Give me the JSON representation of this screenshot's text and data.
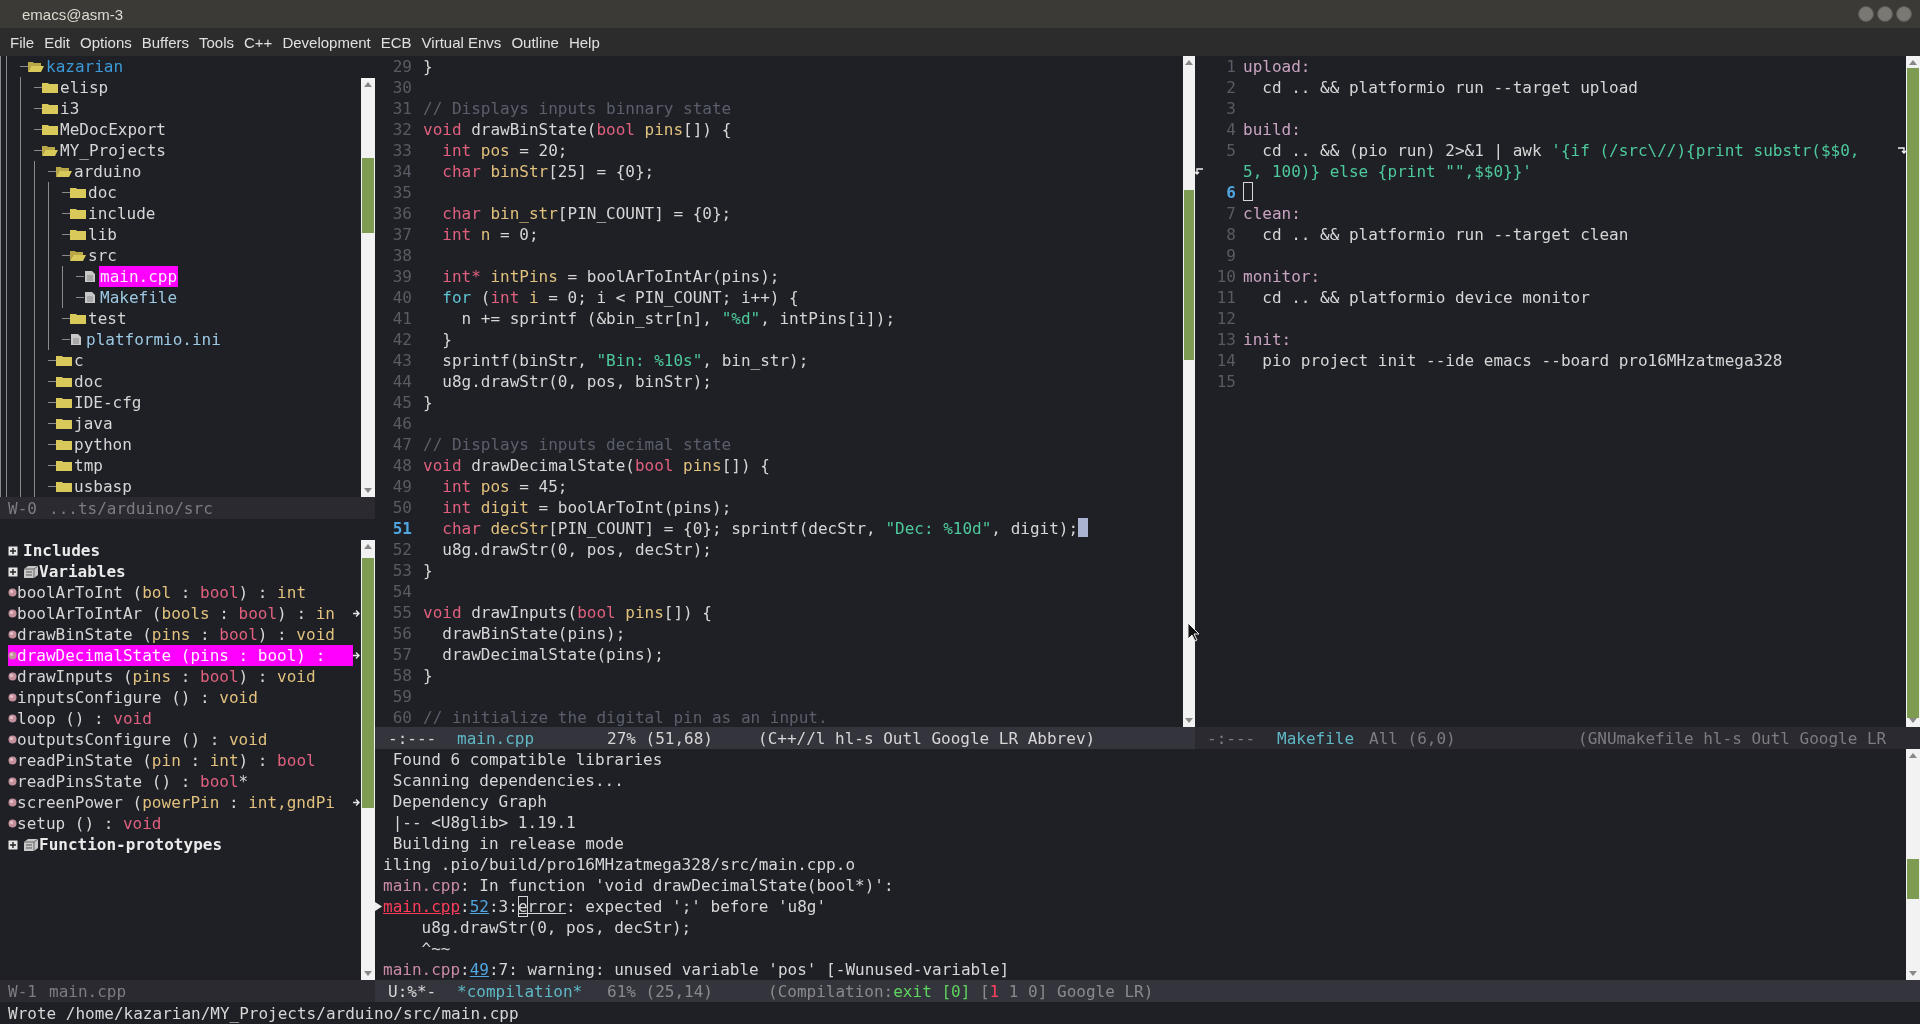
{
  "window": {
    "title": "emacs@asm-3"
  },
  "menu": [
    "File",
    "Edit",
    "Options",
    "Buffers",
    "Tools",
    "C++",
    "Development",
    "ECB",
    "Virtual Envs",
    "Outline",
    "Help"
  ],
  "directory_tree": {
    "items": [
      {
        "name": "kazarian",
        "kind": "folder",
        "expanded": true,
        "selected": false,
        "children": [
          {
            "name": "elisp",
            "kind": "folder",
            "expanded": false,
            "selected": false
          },
          {
            "name": "i3",
            "kind": "folder",
            "expanded": false,
            "selected": false
          },
          {
            "name": "MeDocExport",
            "kind": "folder",
            "expanded": false,
            "selected": false
          },
          {
            "name": "MY_Projects",
            "kind": "folder",
            "expanded": true,
            "selected": false,
            "children": [
              {
                "name": "arduino",
                "kind": "folder",
                "expanded": true,
                "selected": false,
                "children": [
                  {
                    "name": "doc",
                    "kind": "folder",
                    "expanded": false,
                    "selected": false
                  },
                  {
                    "name": "include",
                    "kind": "folder",
                    "expanded": false,
                    "selected": false
                  },
                  {
                    "name": "lib",
                    "kind": "folder",
                    "expanded": false,
                    "selected": false
                  },
                  {
                    "name": "src",
                    "kind": "folder",
                    "expanded": true,
                    "selected": false,
                    "children": [
                      {
                        "name": "main.cpp",
                        "kind": "file",
                        "selected": true
                      },
                      {
                        "name": "Makefile",
                        "kind": "file",
                        "selected": false
                      }
                    ]
                  },
                  {
                    "name": "test",
                    "kind": "folder",
                    "expanded": false,
                    "selected": false
                  },
                  {
                    "name": "platformio.ini",
                    "kind": "file",
                    "selected": false
                  }
                ]
              },
              {
                "name": "c",
                "kind": "folder",
                "expanded": false,
                "selected": false
              },
              {
                "name": "doc",
                "kind": "folder",
                "expanded": false,
                "selected": false
              },
              {
                "name": "IDE-cfg",
                "kind": "folder",
                "expanded": false,
                "selected": false
              },
              {
                "name": "java",
                "kind": "folder",
                "expanded": false,
                "selected": false
              },
              {
                "name": "python",
                "kind": "folder",
                "expanded": false,
                "selected": false
              },
              {
                "name": "tmp",
                "kind": "folder",
                "expanded": false,
                "selected": false
              },
              {
                "name": "usbasp",
                "kind": "folder",
                "expanded": false,
                "selected": false
              }
            ]
          }
        ]
      }
    ],
    "mode_line": {
      "active": false,
      "segments": [
        {
          "kind": "dim",
          "text": "W-0"
        },
        {
          "kind": "dim",
          "text": "...ts/arduino/src"
        }
      ]
    }
  },
  "methods": {
    "items": [
      {
        "kind": "group",
        "label": "Includes",
        "icon": false
      },
      {
        "kind": "group",
        "label": "Variables",
        "icon": true
      },
      {
        "kind": "method",
        "selected": false,
        "truncated": false,
        "tokens": [
          {
            "kind": "txt",
            "text": "boolArToInt ("
          },
          {
            "kind": "var",
            "text": "bol"
          },
          {
            "kind": "txt",
            "text": " : "
          },
          {
            "kind": "kw",
            "text": "bool"
          },
          {
            "kind": "txt",
            "text": ") : "
          },
          {
            "kind": "var",
            "text": "int"
          }
        ]
      },
      {
        "kind": "method",
        "selected": false,
        "truncated": true,
        "tokens": [
          {
            "kind": "txt",
            "text": "boolArToIntAr ("
          },
          {
            "kind": "var",
            "text": "bools"
          },
          {
            "kind": "txt",
            "text": " : "
          },
          {
            "kind": "kw",
            "text": "bool"
          },
          {
            "kind": "txt",
            "text": ") : "
          },
          {
            "kind": "var",
            "text": "in"
          }
        ]
      },
      {
        "kind": "method",
        "selected": false,
        "truncated": false,
        "tokens": [
          {
            "kind": "txt",
            "text": "drawBinState ("
          },
          {
            "kind": "var",
            "text": "pins"
          },
          {
            "kind": "txt",
            "text": " : "
          },
          {
            "kind": "kw",
            "text": "bool"
          },
          {
            "kind": "txt",
            "text": ") : "
          },
          {
            "kind": "var",
            "text": "void"
          }
        ]
      },
      {
        "kind": "method",
        "selected": true,
        "truncated": true,
        "tokens": [
          {
            "kind": "txt",
            "text": "drawDecimalState ("
          },
          {
            "kind": "var",
            "text": "pins"
          },
          {
            "kind": "txt",
            "text": " : "
          },
          {
            "kind": "kw",
            "text": "bool"
          },
          {
            "kind": "txt",
            "text": ") :"
          }
        ]
      },
      {
        "kind": "method",
        "selected": false,
        "truncated": false,
        "tokens": [
          {
            "kind": "txt",
            "text": "drawInputs ("
          },
          {
            "kind": "var",
            "text": "pins"
          },
          {
            "kind": "txt",
            "text": " : "
          },
          {
            "kind": "kw",
            "text": "bool"
          },
          {
            "kind": "txt",
            "text": ") : "
          },
          {
            "kind": "var",
            "text": "void"
          }
        ]
      },
      {
        "kind": "method",
        "selected": false,
        "truncated": false,
        "tokens": [
          {
            "kind": "txt",
            "text": "inputsConfigure () : "
          },
          {
            "kind": "var",
            "text": "void"
          }
        ]
      },
      {
        "kind": "method",
        "selected": false,
        "truncated": false,
        "tokens": [
          {
            "kind": "txt",
            "text": "loop () : "
          },
          {
            "kind": "kw",
            "text": "void"
          }
        ]
      },
      {
        "kind": "method",
        "selected": false,
        "truncated": false,
        "tokens": [
          {
            "kind": "txt",
            "text": "outputsConfigure () : "
          },
          {
            "kind": "var",
            "text": "void"
          }
        ]
      },
      {
        "kind": "method",
        "selected": false,
        "truncated": false,
        "tokens": [
          {
            "kind": "txt",
            "text": "readPinState ("
          },
          {
            "kind": "var",
            "text": "pin"
          },
          {
            "kind": "txt",
            "text": " : "
          },
          {
            "kind": "var",
            "text": "int"
          },
          {
            "kind": "txt",
            "text": ") : "
          },
          {
            "kind": "kw",
            "text": "bool"
          }
        ]
      },
      {
        "kind": "method",
        "selected": false,
        "truncated": false,
        "tokens": [
          {
            "kind": "txt",
            "text": "readPinsState () : "
          },
          {
            "kind": "kw",
            "text": "bool"
          },
          {
            "kind": "txt",
            "text": "*"
          }
        ]
      },
      {
        "kind": "method",
        "selected": false,
        "truncated": true,
        "tokens": [
          {
            "kind": "txt",
            "text": "screenPower ("
          },
          {
            "kind": "var",
            "text": "powerPin"
          },
          {
            "kind": "txt",
            "text": " : "
          },
          {
            "kind": "var",
            "text": "int,gndPi"
          }
        ]
      },
      {
        "kind": "method",
        "selected": false,
        "truncated": false,
        "tokens": [
          {
            "kind": "txt",
            "text": "setup () : "
          },
          {
            "kind": "kw",
            "text": "void"
          }
        ]
      },
      {
        "kind": "group",
        "label": "Function-prototypes",
        "icon": true
      }
    ],
    "mode_line": {
      "active": false,
      "segments": [
        {
          "kind": "dim",
          "text": "W-1"
        },
        {
          "kind": "dim",
          "text": "main.cpp"
        }
      ]
    }
  },
  "code_editor": {
    "lines": [
      {
        "number": "29",
        "current": false,
        "tokens": [
          {
            "kind": "txt",
            "text": "}"
          }
        ]
      },
      {
        "number": "30",
        "current": false
      },
      {
        "number": "31",
        "current": false,
        "tokens": [
          {
            "kind": "cmt",
            "text": "// Displays inputs binnary state"
          }
        ]
      },
      {
        "number": "32",
        "current": false,
        "tokens": [
          {
            "kind": "kw",
            "text": "void"
          },
          {
            "kind": "txt",
            "text": " drawBinState("
          },
          {
            "kind": "kw",
            "text": "bool"
          },
          {
            "kind": "var",
            "text": " pins"
          },
          {
            "kind": "txt",
            "text": "[]) {"
          }
        ]
      },
      {
        "number": "33",
        "current": false,
        "tokens": [
          {
            "kind": "kw",
            "text": "  int"
          },
          {
            "kind": "var",
            "text": " pos"
          },
          {
            "kind": "txt",
            "text": " = 20;"
          }
        ]
      },
      {
        "number": "34",
        "current": false,
        "tokens": [
          {
            "kind": "kw",
            "text": "  char"
          },
          {
            "kind": "var",
            "text": " binStr"
          },
          {
            "kind": "txt",
            "text": "[25] = {0};"
          }
        ]
      },
      {
        "number": "35",
        "current": false
      },
      {
        "number": "36",
        "current": false,
        "tokens": [
          {
            "kind": "kw",
            "text": "  char"
          },
          {
            "kind": "var",
            "text": " bin_str"
          },
          {
            "kind": "txt",
            "text": "[PIN_COUNT] = {0};"
          }
        ]
      },
      {
        "number": "37",
        "current": false,
        "tokens": [
          {
            "kind": "kw",
            "text": "  int"
          },
          {
            "kind": "var",
            "text": " n"
          },
          {
            "kind": "txt",
            "text": " = 0;"
          }
        ]
      },
      {
        "number": "38",
        "current": false
      },
      {
        "number": "39",
        "current": false,
        "tokens": [
          {
            "kind": "kw",
            "text": "  int*"
          },
          {
            "kind": "var",
            "text": " intPins"
          },
          {
            "kind": "txt",
            "text": " = boolArToIntAr(pins);"
          }
        ]
      },
      {
        "number": "40",
        "current": false,
        "tokens": [
          {
            "kind": "ctl",
            "text": "  for"
          },
          {
            "kind": "txt",
            "text": " ("
          },
          {
            "kind": "kw",
            "text": "int"
          },
          {
            "kind": "var",
            "text": " i"
          },
          {
            "kind": "txt",
            "text": " = 0; i < PIN_COUNT; i++) {"
          }
        ]
      },
      {
        "number": "41",
        "current": false,
        "tokens": [
          {
            "kind": "txt",
            "text": "    n += sprintf (&bin_str[n], "
          },
          {
            "kind": "str",
            "text": "\"%d\""
          },
          {
            "kind": "txt",
            "text": ", intPins[i]);"
          }
        ]
      },
      {
        "number": "42",
        "current": false,
        "tokens": [
          {
            "kind": "txt",
            "text": "  }"
          }
        ]
      },
      {
        "number": "43",
        "current": false,
        "tokens": [
          {
            "kind": "txt",
            "text": "  sprintf(binStr, "
          },
          {
            "kind": "str",
            "text": "\"Bin: %10s\""
          },
          {
            "kind": "txt",
            "text": ", bin_str);"
          }
        ]
      },
      {
        "number": "44",
        "current": false,
        "tokens": [
          {
            "kind": "txt",
            "text": "  u8g.drawStr(0, pos, binStr);"
          }
        ]
      },
      {
        "number": "45",
        "current": false,
        "tokens": [
          {
            "kind": "txt",
            "text": "}"
          }
        ]
      },
      {
        "number": "46",
        "current": false
      },
      {
        "number": "47",
        "current": false,
        "tokens": [
          {
            "kind": "cmt",
            "text": "// Displays inputs decimal state"
          }
        ]
      },
      {
        "number": "48",
        "current": false,
        "tokens": [
          {
            "kind": "kw",
            "text": "void"
          },
          {
            "kind": "txt",
            "text": " drawDecimalState("
          },
          {
            "kind": "kw",
            "text": "bool"
          },
          {
            "kind": "var",
            "text": " pins"
          },
          {
            "kind": "txt",
            "text": "[]) {"
          }
        ]
      },
      {
        "number": "49",
        "current": false,
        "tokens": [
          {
            "kind": "kw",
            "text": "  int"
          },
          {
            "kind": "var",
            "text": " pos"
          },
          {
            "kind": "txt",
            "text": " = 45;"
          }
        ]
      },
      {
        "number": "50",
        "current": false,
        "tokens": [
          {
            "kind": "kw",
            "text": "  int"
          },
          {
            "kind": "var",
            "text": " digit"
          },
          {
            "kind": "txt",
            "text": " = boolArToInt(pins);"
          }
        ]
      },
      {
        "number": "51",
        "current": true,
        "tokens": [
          {
            "kind": "kw",
            "text": "  char"
          },
          {
            "kind": "var",
            "text": " decStr"
          },
          {
            "kind": "txt",
            "text": "[PIN_COUNT] = {0}; sprintf(decStr, "
          },
          {
            "kind": "str",
            "text": "\"Dec: %10d\""
          },
          {
            "kind": "txt",
            "text": ", digit);"
          }
        ]
      },
      {
        "number": "52",
        "current": false,
        "tokens": [
          {
            "kind": "txt",
            "text": "  u8g.drawStr(0, pos, decStr);"
          }
        ]
      },
      {
        "number": "53",
        "current": false,
        "tokens": [
          {
            "kind": "txt",
            "text": "}"
          }
        ]
      },
      {
        "number": "54",
        "current": false
      },
      {
        "number": "55",
        "current": false,
        "tokens": [
          {
            "kind": "kw",
            "text": "void"
          },
          {
            "kind": "txt",
            "text": " drawInputs("
          },
          {
            "kind": "kw",
            "text": "bool"
          },
          {
            "kind": "var",
            "text": " pins"
          },
          {
            "kind": "txt",
            "text": "[]) {"
          }
        ]
      },
      {
        "number": "56",
        "current": false,
        "tokens": [
          {
            "kind": "txt",
            "text": "  drawBinState(pins);"
          }
        ]
      },
      {
        "number": "57",
        "current": false,
        "tokens": [
          {
            "kind": "txt",
            "text": "  drawDecimalState(pins);"
          }
        ]
      },
      {
        "number": "58",
        "current": false,
        "tokens": [
          {
            "kind": "txt",
            "text": "}"
          }
        ]
      },
      {
        "number": "59",
        "current": false
      },
      {
        "number": "60",
        "current": false,
        "tokens": [
          {
            "kind": "cmt",
            "text": "// initialize the digital pin as an input."
          }
        ]
      }
    ],
    "mode_line": {
      "active": true,
      "segments": [
        {
          "kind": "txt",
          "text": "-:---"
        },
        {
          "kind": "buf",
          "text": "main.cpp"
        },
        {
          "kind": "txt",
          "text": "27% (51,68)"
        },
        {
          "kind": "txt",
          "text": "(C++//l hl-s Outl Google LR Abbrev)"
        }
      ]
    }
  },
  "makefile_editor": {
    "lines": [
      {
        "number": "1",
        "current": false,
        "tokens": [
          {
            "kind": "tgt",
            "text": "upload:"
          }
        ]
      },
      {
        "number": "2",
        "current": false,
        "tokens": [
          {
            "kind": "txt",
            "text": "  cd .. && platformio run --target upload"
          }
        ]
      },
      {
        "number": "3",
        "current": false
      },
      {
        "number": "4",
        "current": false,
        "tokens": [
          {
            "kind": "tgt",
            "text": "build:"
          }
        ]
      },
      {
        "number": "5",
        "current": false,
        "tokens": [
          {
            "kind": "txt",
            "text": "  cd .. && (pio run) 2>&1 | awk "
          },
          {
            "kind": "str",
            "text": "'{if (/src\\//){print substr($$0,"
          }
        ],
        "continuation": [
          {
            "kind": "str",
            "text": "5, 100)} else {print \"\",$$0}}'"
          }
        ]
      },
      {
        "number": "6",
        "current": true
      },
      {
        "number": "7",
        "current": false,
        "tokens": [
          {
            "kind": "tgt",
            "text": "clean:"
          }
        ]
      },
      {
        "number": "8",
        "current": false,
        "tokens": [
          {
            "kind": "txt",
            "text": "  cd .. && platformio run --target clean"
          }
        ]
      },
      {
        "number": "9",
        "current": false
      },
      {
        "number": "10",
        "current": false,
        "tokens": [
          {
            "kind": "tgt",
            "text": "monitor:"
          }
        ]
      },
      {
        "number": "11",
        "current": false,
        "tokens": [
          {
            "kind": "txt",
            "text": "  cd .. && platformio device monitor"
          }
        ]
      },
      {
        "number": "12",
        "current": false
      },
      {
        "number": "13",
        "current": false,
        "tokens": [
          {
            "kind": "tgt",
            "text": "init:"
          }
        ]
      },
      {
        "number": "14",
        "current": false,
        "tokens": [
          {
            "kind": "txt",
            "text": "  pio project init --ide emacs --board pro16MHzatmega328"
          }
        ]
      },
      {
        "number": "15",
        "current": false
      }
    ],
    "mode_line": {
      "active": false,
      "segments": [
        {
          "kind": "dim",
          "text": "-:---"
        },
        {
          "kind": "buf",
          "text": "Makefile"
        },
        {
          "kind": "dim",
          "text": "All (6,0)"
        },
        {
          "kind": "dim",
          "text": "(GNUmakefile hl-s Outl Google LR"
        }
      ]
    }
  },
  "compilation": {
    "lines": [
      {
        "current": false,
        "tokens": [
          {
            "kind": "txt",
            "text": " Found 6 compatible libraries"
          }
        ]
      },
      {
        "current": false,
        "tokens": [
          {
            "kind": "txt",
            "text": " Scanning dependencies..."
          }
        ]
      },
      {
        "current": false,
        "tokens": [
          {
            "kind": "txt",
            "text": " Dependency Graph"
          }
        ]
      },
      {
        "current": false,
        "tokens": [
          {
            "kind": "txt",
            "text": " |-- <U8glib> 1.19.1"
          }
        ]
      },
      {
        "current": false,
        "tokens": [
          {
            "kind": "txt",
            "text": " Building in release mode"
          }
        ]
      },
      {
        "current": false,
        "tokens": [
          {
            "kind": "txt",
            "text": "iling .pio/build/pro16MHzatmega328/src/main.cpp.o"
          }
        ]
      },
      {
        "current": false,
        "tokens": [
          {
            "kind": "file",
            "text": "main.cpp"
          },
          {
            "kind": "txt",
            "text": ": In function 'void drawDecimalState(bool*)':"
          }
        ]
      },
      {
        "current": true,
        "tokens": [
          {
            "kind": "err",
            "text": "main.cpp"
          },
          {
            "kind": "txt",
            "text": ":"
          },
          {
            "kind": "num",
            "text": "52"
          },
          {
            "kind": "txt",
            "text": ":3:"
          },
          {
            "kind": "point",
            "text": "e"
          },
          {
            "kind": "ul",
            "text": "rror"
          },
          {
            "kind": "txt",
            "text": ": expected ';' before 'u8g'"
          }
        ]
      },
      {
        "current": false,
        "tokens": [
          {
            "kind": "txt",
            "text": "    u8g.drawStr(0, pos, decStr);"
          }
        ]
      },
      {
        "current": false,
        "tokens": [
          {
            "kind": "txt",
            "text": "    ^~~"
          }
        ]
      },
      {
        "current": false,
        "tokens": [
          {
            "kind": "file",
            "text": "main.cpp"
          },
          {
            "kind": "txt",
            "text": ":"
          },
          {
            "kind": "num",
            "text": "49"
          },
          {
            "kind": "txt",
            "text": ":7: warning: unused variable 'pos' [-Wunused-variable]"
          }
        ]
      }
    ],
    "mode_line": {
      "active": true,
      "segments": [
        {
          "kind": "txt",
          "text": "U:%*-"
        },
        {
          "kind": "buf",
          "text": "*compilation*"
        },
        {
          "kind": "dim",
          "text": "61% (25,14)"
        },
        {
          "kind": "dim",
          "text": "(Compilation:"
        },
        {
          "kind": "ok",
          "text": "exit [0]"
        },
        {
          "kind": "dim",
          "text": " ["
        },
        {
          "kind": "bad",
          "text": "1"
        },
        {
          "kind": "dim",
          "text": " 1 0] Google LR)"
        }
      ]
    }
  },
  "minibuffer": "Wrote /home/kazarian/MY_Projects/arduino/src/main.cpp"
}
